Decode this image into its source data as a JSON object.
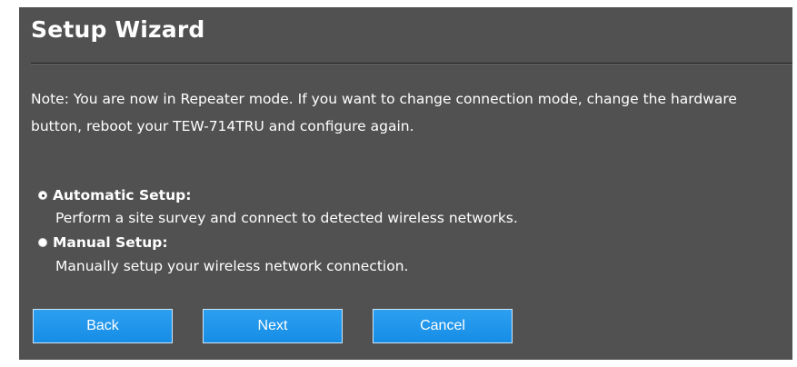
{
  "wizard": {
    "title": "Setup Wizard",
    "note": "Note: You are now in Repeater mode. If you want to change connection mode, change the hardware button, reboot your TEW-714TRU and configure again.",
    "options": [
      {
        "label": "Automatic Setup:",
        "description": "Perform a site survey and connect to detected wireless networks.",
        "selected": true
      },
      {
        "label": "Manual Setup:",
        "description": "Manually setup your wireless network connection.",
        "selected": false
      }
    ],
    "buttons": {
      "back": "Back",
      "next": "Next",
      "cancel": "Cancel"
    }
  },
  "colors": {
    "panel_background": "#515151",
    "button_blue": "#1f96eb",
    "text": "#ffffff"
  }
}
